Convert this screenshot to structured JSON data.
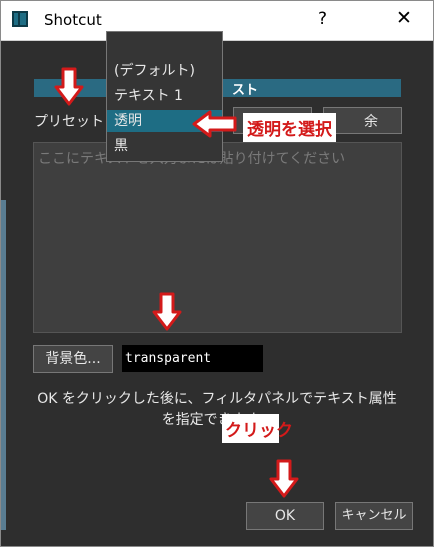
{
  "window": {
    "title": "Shotcut",
    "help": "?",
    "close": "✕"
  },
  "section": {
    "header_visible": "スト"
  },
  "preset": {
    "label": "プリセット",
    "hidden_button_fragment": "余"
  },
  "dropdown": {
    "options": [
      "(デフォルト)",
      "テキスト 1",
      "透明",
      "黒"
    ],
    "selected_index": 2
  },
  "text_area": {
    "placeholder": "ここにテキストを入力または貼り付けてください"
  },
  "background": {
    "button_label": "背景色...",
    "value": "transparent"
  },
  "info": {
    "text": "OK をクリックした後に、フィルタパネルでテキスト属性を指定できます。"
  },
  "buttons": {
    "ok": "OK",
    "cancel": "キャンセル"
  },
  "annotations": {
    "select_transparent": "透明を選択",
    "click": "クリック"
  },
  "colors": {
    "accent": "#1e6d84",
    "annotation_red": "#d31a1a",
    "dialog_bg": "#2e2e2e"
  }
}
